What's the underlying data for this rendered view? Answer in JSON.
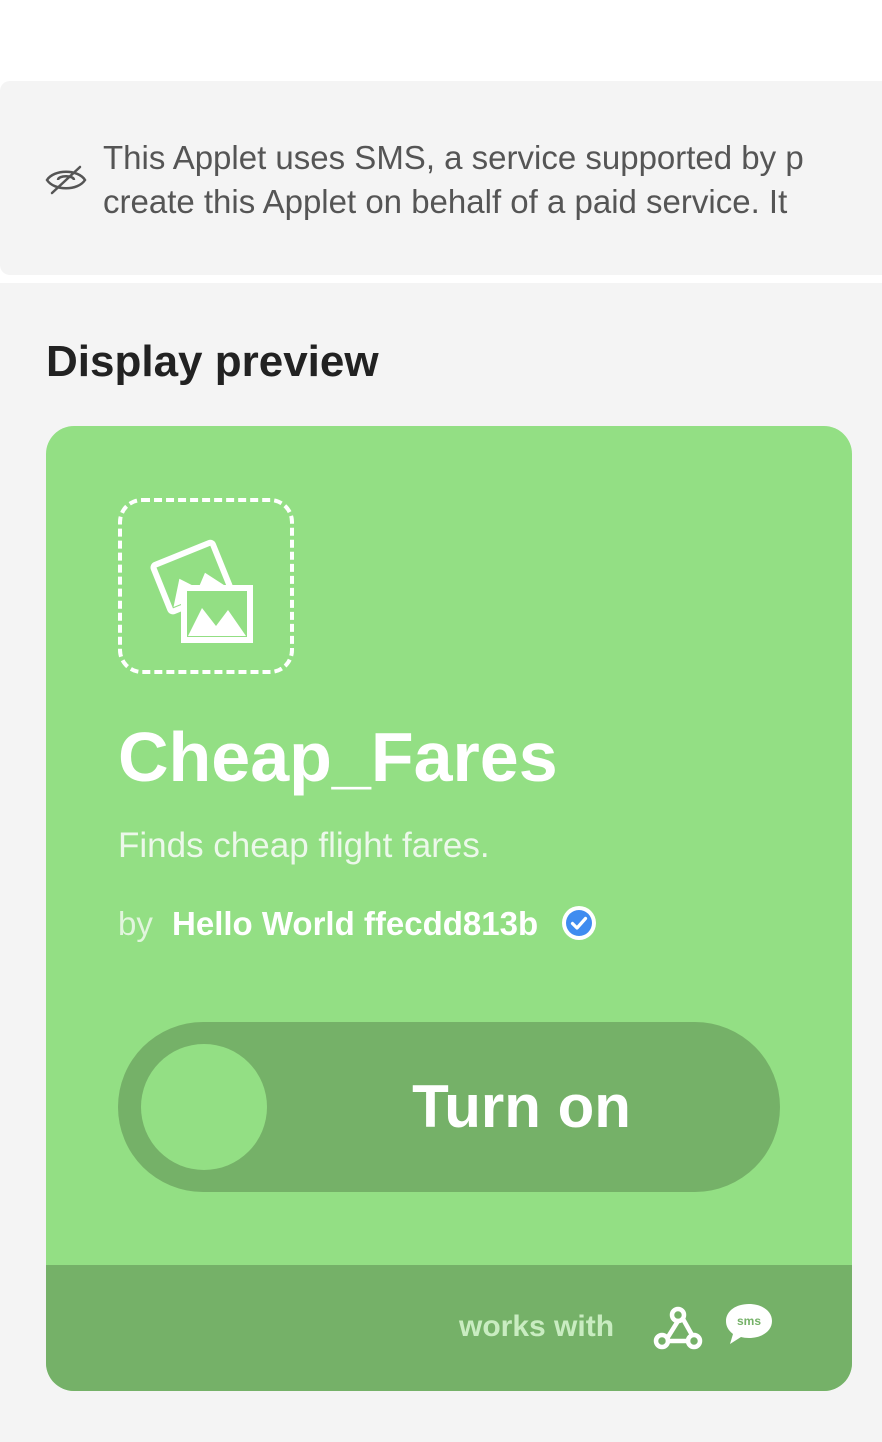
{
  "notice": {
    "icon": "eye-slash-icon",
    "line1": "This Applet uses SMS, a service supported by p",
    "line2": "create this Applet on behalf of a paid service. It"
  },
  "preview": {
    "title": "Display preview"
  },
  "card": {
    "background_color": "#93df84",
    "footer_color": "#75b168",
    "image_icon": "image-placeholder-icon",
    "title": "Cheap_Fares",
    "description": "Finds cheap flight fares.",
    "by_label": "by",
    "author": "Hello World ffecdd813b",
    "verified_icon": "verified-check-icon",
    "toggle_label": "Turn on",
    "works_with_label": "works with",
    "services": [
      {
        "name": "webhooks-icon"
      },
      {
        "name": "sms-icon",
        "label": "sms"
      }
    ]
  }
}
